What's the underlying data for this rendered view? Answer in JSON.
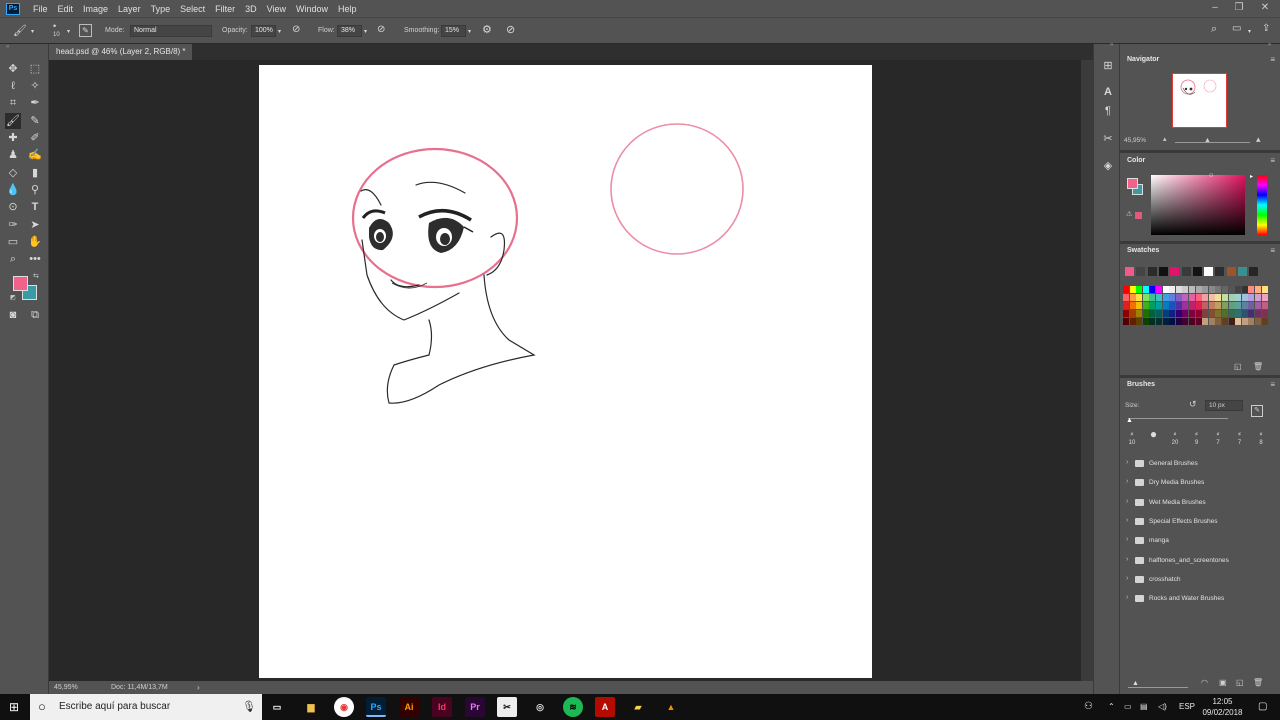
{
  "menubar": {
    "logo": "Ps",
    "items": [
      "File",
      "Edit",
      "Image",
      "Layer",
      "Type",
      "Select",
      "Filter",
      "3D",
      "View",
      "Window",
      "Help"
    ]
  },
  "options": {
    "brush_size": "10",
    "mode_label": "Mode:",
    "mode_value": "Normal",
    "opacity_label": "Opacity:",
    "opacity_value": "100%",
    "flow_label": "Flow:",
    "flow_value": "38%",
    "smoothing_label": "Smoothing:",
    "smoothing_value": "15%"
  },
  "document": {
    "tab_title": "head.psd @ 46% (Layer 2, RGB/8) *",
    "tab_close": "×"
  },
  "status": {
    "zoom": "45,95%",
    "doc_size": "Doc: 11,4M/13,7M",
    "arrow": "›"
  },
  "navigator": {
    "title": "Navigator",
    "zoom": "45,95%"
  },
  "color_panel": {
    "title": "Color",
    "fg": "#f0628a",
    "bg": "#3a9aa6"
  },
  "swatches": {
    "title": "Swatches",
    "recent": [
      "#f25a8a",
      "#444444",
      "#2b2b2b",
      "#111111",
      "#e2136f",
      "#3a3a3a",
      "#141414",
      "#ffffff",
      "#2d2d2d",
      "#a0522d",
      "#3b8f8f",
      "#262626"
    ]
  },
  "brushes": {
    "title": "Brushes",
    "size_label": "Size:",
    "size_value": "10 px",
    "tips": [
      "10",
      "",
      "20",
      "9",
      "7",
      "7",
      "8"
    ],
    "folders": [
      "General Brushes",
      "Dry Media Brushes",
      "Wet Media Brushes",
      "Special Effects Brushes",
      "manga",
      "halftones_and_screentones",
      "crosshatch",
      "Rocks and Water Brushes"
    ]
  },
  "taskbar": {
    "search_placeholder": "Escribe aquí para buscar",
    "apps": [
      "Ps",
      "Ai",
      "Id",
      "Pr",
      "A"
    ],
    "lang": "ESP",
    "time": "12:05",
    "date": "09/02/2018"
  },
  "colors": {
    "ui_panel": "#535353",
    "canvas_bg": "#282828",
    "sketch_pink": "#e8708f"
  }
}
